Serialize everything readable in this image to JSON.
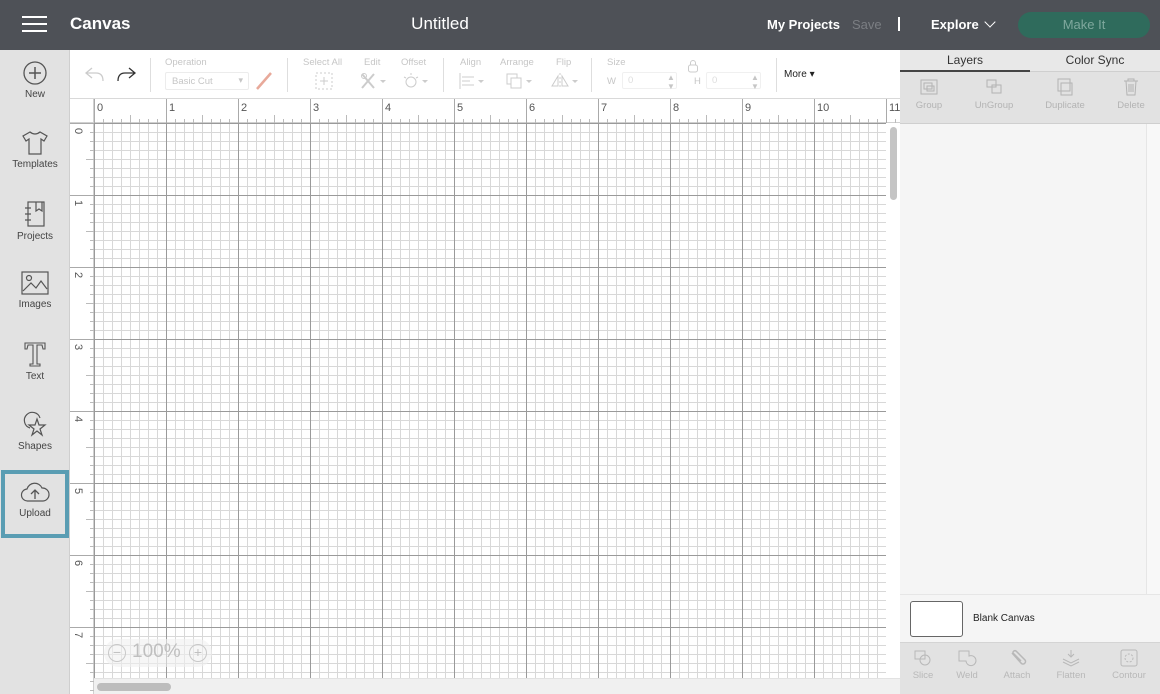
{
  "topbar": {
    "app_title": "Canvas",
    "doc_title": "Untitled",
    "my_projects": "My Projects",
    "save": "Save",
    "explore": "Explore",
    "make_it": "Make It"
  },
  "sidebar": {
    "items": [
      {
        "label": "New",
        "icon": "plus-circle-icon"
      },
      {
        "label": "Templates",
        "icon": "tshirt-icon"
      },
      {
        "label": "Projects",
        "icon": "notebook-icon"
      },
      {
        "label": "Images",
        "icon": "image-icon"
      },
      {
        "label": "Text",
        "icon": "text-icon"
      },
      {
        "label": "Shapes",
        "icon": "shapes-icon"
      },
      {
        "label": "Upload",
        "icon": "cloud-upload-icon",
        "active": true
      }
    ]
  },
  "toolbar": {
    "operation_label": "Operation",
    "operation_value": "Basic Cut",
    "select_all": "Select All",
    "edit": "Edit",
    "offset": "Offset",
    "align": "Align",
    "arrange": "Arrange",
    "flip": "Flip",
    "size_label": "Size",
    "w_label": "W",
    "w_value": "0",
    "h_label": "H",
    "h_value": "0",
    "more": "More"
  },
  "canvas": {
    "ruler_x": [
      "0",
      "1",
      "2",
      "3",
      "4",
      "5",
      "6",
      "7",
      "8",
      "9",
      "10",
      "11"
    ],
    "ruler_y": [
      "0",
      "1",
      "2",
      "3",
      "4",
      "5",
      "6",
      "7"
    ],
    "zoom_level": "100%",
    "zoom_out": "−",
    "zoom_in": "+"
  },
  "right_panel": {
    "tabs": [
      "Layers",
      "Color Sync"
    ],
    "layer_tools": [
      "Group",
      "UnGroup",
      "Duplicate",
      "Delete"
    ],
    "blank_canvas_label": "Blank Canvas",
    "bottom_tools": [
      "Slice",
      "Weld",
      "Attach",
      "Flatten",
      "Contour"
    ]
  },
  "colors": {
    "topbar_bg": "#4e5157",
    "make_it_bg": "#2f6b5c",
    "active_highlight": "#5a9db3"
  }
}
